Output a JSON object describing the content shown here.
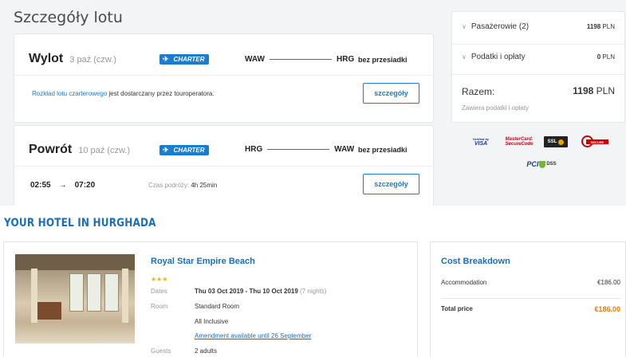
{
  "flight": {
    "title": "Szczegóły lotu",
    "outbound": {
      "direction": "Wylot",
      "date": "3 paź (czw.)",
      "badge": "CHARTER",
      "from": "WAW",
      "to": "HRG",
      "stops": "bez przesiadki",
      "note_link": "Rozkład lotu czarterowego",
      "note_text": " jest dostarczany przez touroperatora.",
      "details_label": "szczegóły"
    },
    "return": {
      "direction": "Powrót",
      "date": "10 paź (czw.)",
      "badge": "CHARTER",
      "from": "HRG",
      "to": "WAW",
      "stops": "bez przesiadki",
      "depart_time": "02:55",
      "arrow": "→",
      "arrive_time": "07:20",
      "duration_label": "Czas podróży: ",
      "duration_value": "4h 25min",
      "details_label": "szczegóły"
    }
  },
  "summary": {
    "passengers_label": "Pasażerowie (2)",
    "passengers_value": "1198",
    "passengers_currency": " PLN",
    "fees_label": "Podatki i opłaty",
    "fees_value": "0",
    "fees_currency": " PLN",
    "total_label": "Razem:",
    "total_value": "1198",
    "total_currency": " PLN",
    "total_note": "Zawiera podatki i opłaty"
  },
  "security_logos": {
    "visa_top": "Verified by",
    "visa_bottom": "VISA",
    "mc_top": "MasterCard.",
    "mc_bottom": "SecureCode",
    "ssl": "SSL",
    "secure": "SECURE",
    "pci": "PCI",
    "dss": "DSS"
  },
  "hotel": {
    "heading": "YOUR HOTEL IN HURGHADA",
    "name": "Royal Star Empire Beach",
    "stars": "★★★",
    "star_rating": 3,
    "dates_label": "Dates",
    "dates_value": "Thu 03 Oct 2019 - Thu 10 Oct 2019",
    "dates_nights": " (7 nights)",
    "room_label": "Room",
    "room_value": "Standard Room",
    "board_value": "All Inclusive",
    "amendment_link": "Amendment available until 26 September",
    "guests_label": "Guests",
    "guests_value": "2 adults"
  },
  "cost": {
    "title": "Cost Breakdown",
    "accommodation_label": "Accommodation",
    "accommodation_value": "€186.00",
    "total_label": "Total price",
    "total_value": "€186.00"
  },
  "colors": {
    "accent": "#1a7ccf",
    "heading_blue": "#1a6fb8",
    "total_orange": "#f07800",
    "stars": "#f3b400"
  }
}
